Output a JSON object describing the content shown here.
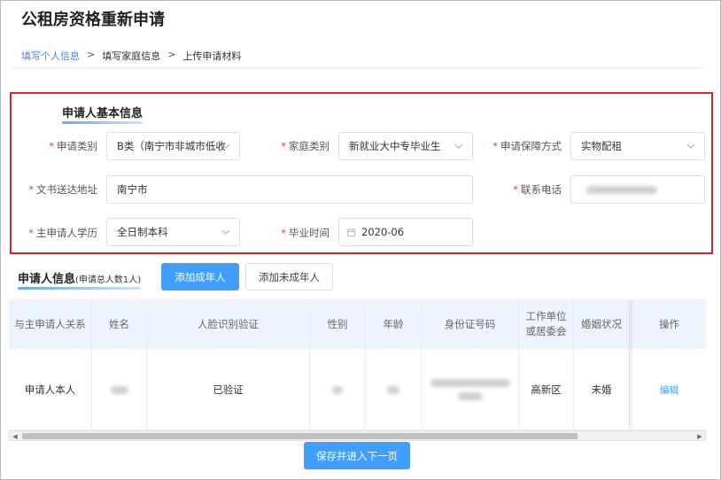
{
  "page": {
    "title": "公租房资格重新申请"
  },
  "breadcrumb": {
    "step1": "填写个人信息",
    "sep": ">",
    "step2": "填写家庭信息",
    "step3": "上传申请材料"
  },
  "basic_info": {
    "title": "申请人基本信息",
    "required_mark": "*",
    "apply_type": {
      "label": "申请类别",
      "value": "B类（南宁市非城市低收"
    },
    "family_type": {
      "label": "家庭类别",
      "value": "新就业大中专毕业生"
    },
    "guarantee_type": {
      "label": "申请保障方式",
      "value": "实物配租"
    },
    "address": {
      "label": "文书送达地址",
      "value": "南宁市"
    },
    "phone": {
      "label": "联系电话",
      "value": ""
    },
    "education": {
      "label": "主申请人学历",
      "value": "全日制本科"
    },
    "graduation": {
      "label": "毕业时间",
      "value": "2020-06"
    }
  },
  "applicant_section": {
    "title": "申请人信息",
    "count_note": "(申请总人数1人)",
    "add_adult": "添加成年人",
    "add_minor": "添加未成年人"
  },
  "table": {
    "headers": {
      "relation": "与主申请人关系",
      "name": "姓名",
      "face": "人脸识别验证",
      "gender": "性别",
      "age": "年龄",
      "id_number": "身份证号码",
      "work_unit_1": "工作单位",
      "work_unit_2": "或居委会",
      "marital": "婚姻状况",
      "action": "操作"
    },
    "rows": [
      {
        "relation": "申请人本人",
        "face": "已验证",
        "work_unit": "高新区",
        "marital": "未婚",
        "action": "编辑"
      }
    ]
  },
  "footer": {
    "save_next": "保存并进入下一页"
  },
  "colors": {
    "accent": "#409eff",
    "highlight_border": "#d9232d",
    "required": "#e0452f"
  }
}
